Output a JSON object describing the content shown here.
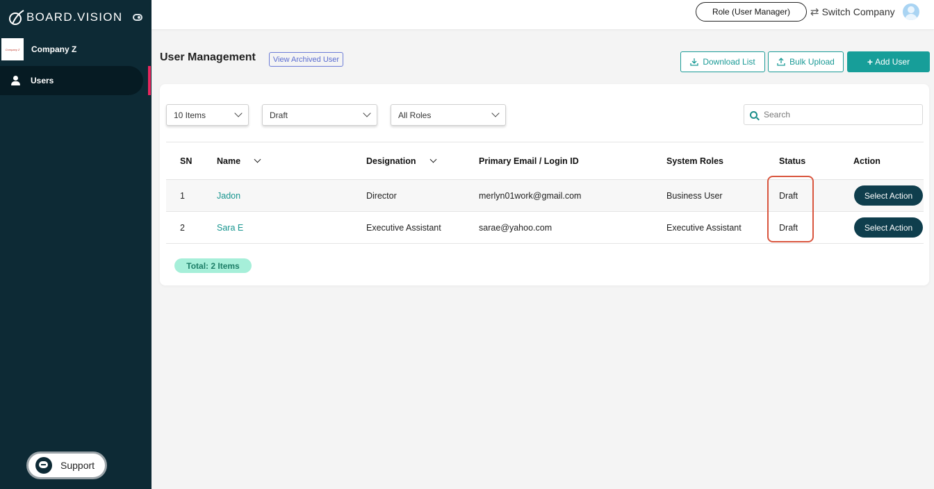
{
  "brand": {
    "name": "BOARD.VISION"
  },
  "sidebar": {
    "company_name": "Company Z",
    "company_logo_text": "Company Z",
    "items": [
      {
        "label": "Users",
        "icon": "user-icon"
      }
    ],
    "support_label": "Support"
  },
  "topbar": {
    "role_label": "Role (User Manager)",
    "switch_company_label": "Switch Company"
  },
  "header": {
    "title": "User Management",
    "archived_link": "View Archived User",
    "download_label": "Download List",
    "upload_label": "Bulk Upload",
    "add_label": "Add User"
  },
  "filters": {
    "items_per_page": "10 Items",
    "status": "Draft",
    "roles": "All Roles",
    "search_placeholder": "Search"
  },
  "table": {
    "columns": [
      "SN",
      "Name",
      "Designation",
      "Primary Email / Login ID",
      "System Roles",
      "Status",
      "Action"
    ],
    "rows": [
      {
        "sn": "1",
        "name": "Jadon",
        "designation": "Director",
        "email": "merlyn01work@gmail.com",
        "roles": "Business User",
        "status": "Draft",
        "action": "Select Action"
      },
      {
        "sn": "2",
        "name": "Sara E",
        "designation": "Executive Assistant",
        "email": "sarae@yahoo.com",
        "roles": "Executive Assistant",
        "status": "Draft",
        "action": "Select Action"
      }
    ],
    "total": "Total: 2 Items"
  },
  "colors": {
    "sidebar": "#0d2a35",
    "accent_teal": "#179e99",
    "nav_accent": "#e9275e",
    "action_button": "#0f3e4d",
    "highlight": "#d9553e"
  }
}
